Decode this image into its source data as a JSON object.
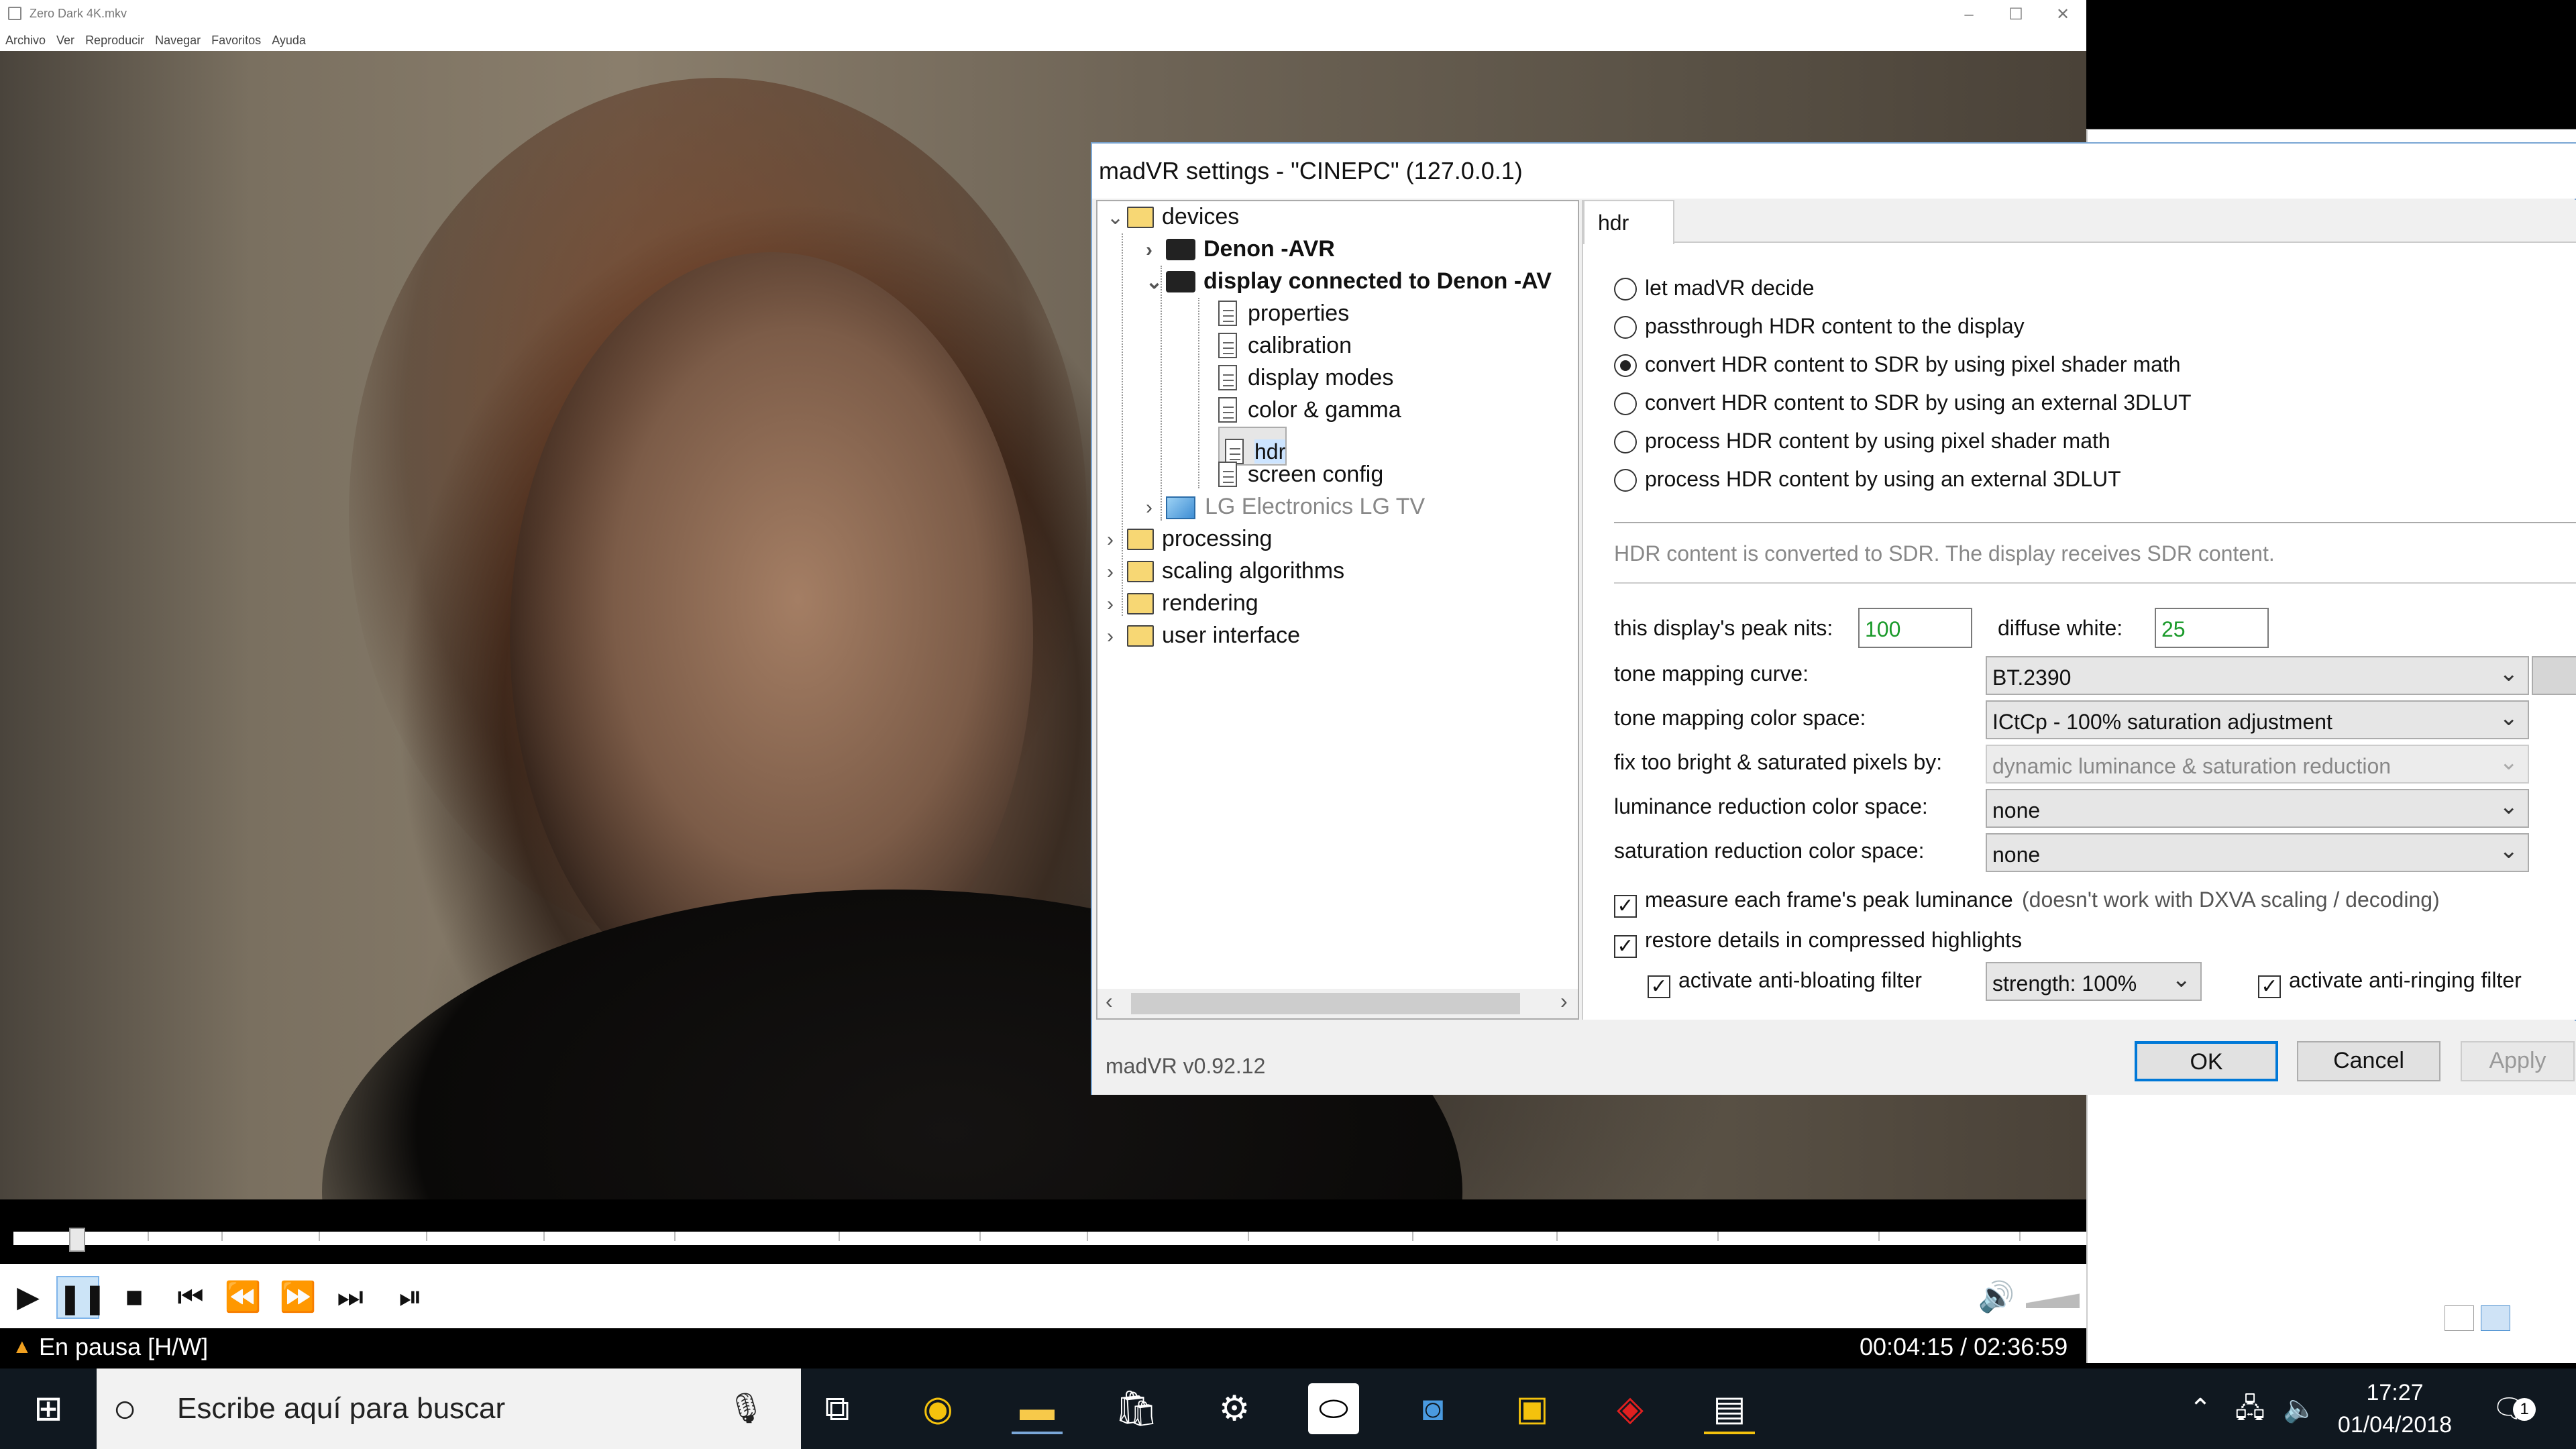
{
  "player": {
    "title": "Zero Dark 4K.mkv",
    "menu": [
      "Archivo",
      "Ver",
      "Reproducir",
      "Navegar",
      "Favoritos",
      "Ayuda"
    ],
    "status_text": "En pausa [H/W]",
    "time": "00:04:15 / 02:36:59",
    "progress_fraction": 0.027
  },
  "dialog": {
    "title": "madVR settings - \"CINEPC\" (127.0.0.1)",
    "tree": {
      "devices": "devices",
      "denon": "Denon -AVR",
      "display": "display connected to Denon -AV",
      "properties": "properties",
      "calibration": "calibration",
      "display_modes": "display modes",
      "color_gamma": "color & gamma",
      "hdr": "hdr",
      "screen_config": "screen config",
      "lg": "LG Electronics LG TV",
      "processing": "processing",
      "scaling": "scaling algorithms",
      "rendering": "rendering",
      "user_interface": "user interface"
    },
    "tab": "hdr",
    "radios": [
      {
        "label": "let madVR decide",
        "checked": false
      },
      {
        "label": "passthrough HDR content to the display",
        "checked": false
      },
      {
        "label": "convert HDR content to SDR by using pixel shader math",
        "checked": true
      },
      {
        "label": "convert HDR content to SDR by using an external 3DLUT",
        "checked": false
      },
      {
        "label": "process HDR content by using pixel shader math",
        "checked": false
      },
      {
        "label": "process HDR content by using an external 3DLUT",
        "checked": false
      }
    ],
    "info_text": "HDR content is converted to SDR. The display receives SDR content.",
    "peak_nits_label": "this display's peak nits:",
    "peak_nits_value": "100",
    "diffuse_white_label": "diffuse white:",
    "diffuse_white_value": "25",
    "settings": [
      {
        "label": "tone mapping curve:",
        "value": "BT.2390",
        "disabled": false
      },
      {
        "label": "tone mapping color space:",
        "value": "ICtCp - 100% saturation adjustment",
        "disabled": false
      },
      {
        "label": "fix too bright & saturated pixels by:",
        "value": "dynamic luminance & saturation reduction",
        "disabled": true
      },
      {
        "label": "luminance reduction color space:",
        "value": "none",
        "disabled": false
      },
      {
        "label": "saturation reduction color space:",
        "value": "none",
        "disabled": false
      }
    ],
    "measure_label": "measure each frame's peak luminance",
    "measure_note": "(doesn't work with DXVA scaling / decoding)",
    "restore_label": "restore details in compressed highlights",
    "antibloat_label": "activate anti-bloating filter",
    "strength_value": "strength: 100%",
    "antiring_label": "activate anti-ringing filter",
    "version": "madVR v0.92.12",
    "ok": "OK",
    "cancel": "Cancel",
    "apply": "Apply"
  },
  "taskbar": {
    "search_placeholder": "Escribe aquí para buscar",
    "time": "17:27",
    "date": "01/04/2018",
    "notifications": "1"
  },
  "icons": [
    "windows-logo-icon",
    "search-circle-icon",
    "microphone-icon",
    "task-view-icon",
    "chrome-icon",
    "file-explorer-icon",
    "store-icon",
    "steam-icon",
    "oculus-icon",
    "vr-headset-icon",
    "sab-icon",
    "game-icon",
    "mpc-icon",
    "chevron-up-icon",
    "network-icon",
    "volume-icon",
    "notification-icon"
  ]
}
